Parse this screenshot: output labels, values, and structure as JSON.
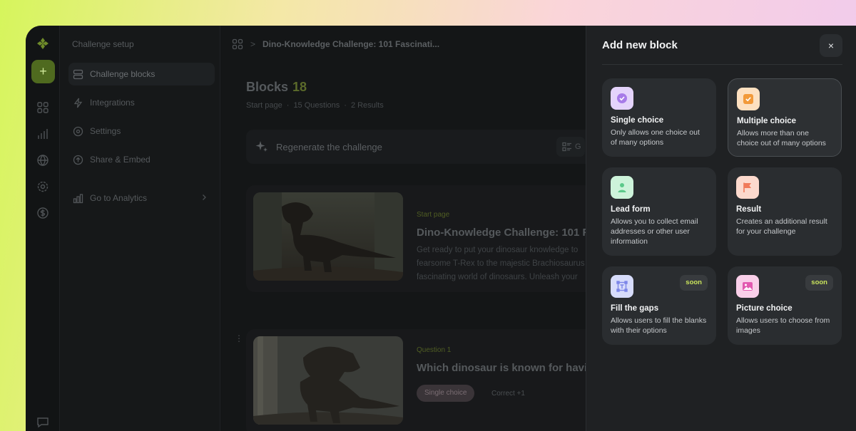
{
  "sidebar": {
    "title": "Challenge setup",
    "items": [
      {
        "label": "Challenge blocks"
      },
      {
        "label": "Integrations"
      },
      {
        "label": "Settings"
      },
      {
        "label": "Share & Embed"
      },
      {
        "label": "Go to Analytics"
      }
    ]
  },
  "rail": {
    "add_label": "+"
  },
  "breadcrumb": {
    "separator": ">",
    "current": "Dino-Knowledge Challenge: 101 Fascinati..."
  },
  "main": {
    "blocks_label": "Blocks",
    "blocks_count": "18",
    "meta": [
      "Start page",
      "·",
      "15 Questions",
      "·",
      "2 Results"
    ],
    "regenerate_label": "Regenerate the challenge",
    "view_toggle_label": "G",
    "cards": [
      {
        "kicker": "Start page",
        "heading": "Dino-Knowledge Challenge: 101 F",
        "body": "Get ready to put your dinosaur knowledge to fearsome T-Rex to the majestic Brachiosaurus fascinating world of dinosaurs. Unleash your"
      },
      {
        "kicker": "Question 1",
        "heading": "Which dinosaur is known for havi",
        "pill": "Single choice",
        "correct": "Correct +1"
      }
    ]
  },
  "panel": {
    "title": "Add new block",
    "close": "×",
    "blocks": [
      {
        "title": "Single choice",
        "desc": "Only allows one choice out of many options",
        "icon": "check-circle-icon",
        "color": "#a77be8"
      },
      {
        "title": "Multiple choice",
        "desc": "Allows more than one choice out of many options",
        "icon": "check-square-icon",
        "color": "#f29a3a"
      },
      {
        "title": "Lead form",
        "desc": "Allows you to collect email addresses or other user information",
        "icon": "user-icon",
        "color": "#5cc98a"
      },
      {
        "title": "Result",
        "desc": "Creates an additional result for your challenge",
        "icon": "flag-icon",
        "color": "#f07a5a"
      },
      {
        "title": "Fill the gaps",
        "desc": "Allows users to fill the blanks with their options",
        "icon": "text-frame-icon",
        "color": "#7c86e8",
        "badge": "soon"
      },
      {
        "title": "Picture choice",
        "desc": "Allows users to choose from images",
        "icon": "image-icon",
        "color": "#e25ab0",
        "badge": "soon"
      }
    ]
  }
}
